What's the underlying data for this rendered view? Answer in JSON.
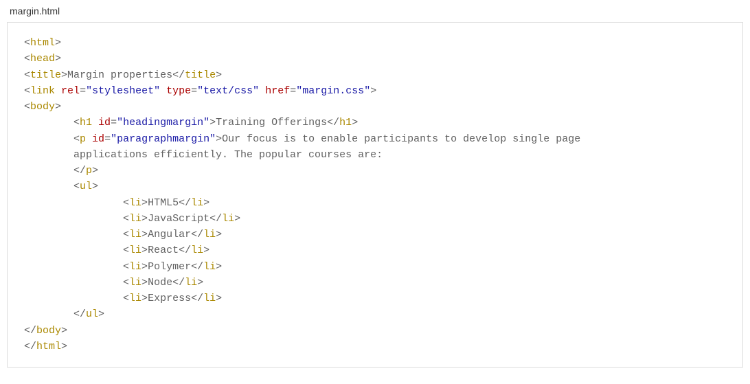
{
  "filename": "margin.html",
  "code": {
    "tag_html": "html",
    "tag_head": "head",
    "tag_title": "title",
    "title_text": "Margin properties",
    "tag_link": "link",
    "attr_rel": "rel",
    "val_rel": "\"stylesheet\"",
    "attr_type": "type",
    "val_type": "\"text/css\"",
    "attr_href": "href",
    "val_href": "\"margin.css\"",
    "tag_body": "body",
    "tag_h1": "h1",
    "attr_id": "id",
    "val_h1_id": "\"headingmargin\"",
    "h1_text": "Training Offerings",
    "tag_p": "p",
    "val_p_id": "\"paragraphmargin\"",
    "p_text_l1": "Our focus is to enable participants to develop single page",
    "p_text_l2": "applications efficiently. The popular courses are:",
    "tag_ul": "ul",
    "tag_li": "li",
    "li1": "HTML5",
    "li2": "JavaScript",
    "li3": "Angular",
    "li4": "React",
    "li5": "Polymer",
    "li6": "Node",
    "li7": "Express"
  }
}
